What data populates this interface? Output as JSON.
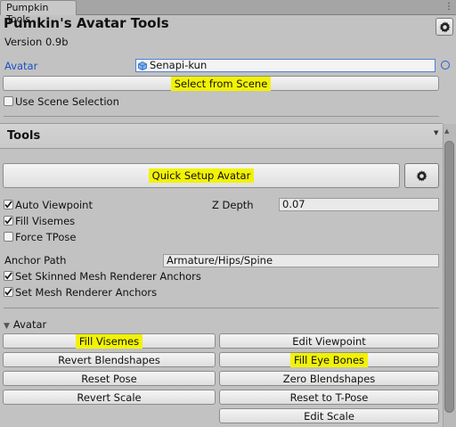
{
  "tab": {
    "label": "Pumpkin Tools",
    "menu_icon": "kebab-menu-icon"
  },
  "header": {
    "title": "Pumkin's Avatar Tools",
    "version": "Version 0.9b",
    "settings_icon": "gear-icon"
  },
  "avatar_field": {
    "label": "Avatar",
    "value": "Senapi-kun",
    "object_icon": "cube-icon",
    "picker_icon": "object-picker-icon"
  },
  "select_button": {
    "label": "Select from Scene"
  },
  "use_scene_selection": {
    "label": "Use Scene Selection",
    "checked": false
  },
  "tools_section": {
    "title": "Tools",
    "collapse_icon": "dropdown-arrow-icon"
  },
  "quick_setup": {
    "label": "Quick Setup Avatar",
    "settings_icon": "gear-icon"
  },
  "options": {
    "auto_viewpoint": {
      "label": "Auto Viewpoint",
      "checked": true
    },
    "fill_visemes": {
      "label": "Fill Visemes",
      "checked": true
    },
    "force_tpose": {
      "label": "Force TPose",
      "checked": false
    },
    "z_depth": {
      "label": "Z Depth",
      "value": "0.07"
    },
    "anchor_path": {
      "label": "Anchor Path",
      "value": "Armature/Hips/Spine"
    },
    "set_skinned_anchors": {
      "label": "Set Skinned Mesh Renderer Anchors",
      "checked": true
    },
    "set_mesh_anchors": {
      "label": "Set Mesh Renderer Anchors",
      "checked": true
    }
  },
  "avatar_foldout": {
    "label": "Avatar",
    "expanded": true
  },
  "avatar_buttons": {
    "fill_visemes": "Fill Visemes",
    "edit_viewpoint": "Edit Viewpoint",
    "revert_blendshapes": "Revert Blendshapes",
    "fill_eye_bones": "Fill Eye Bones",
    "reset_pose": "Reset Pose",
    "zero_blendshapes": "Zero Blendshapes",
    "revert_scale": "Revert Scale",
    "reset_to_tpose": "Reset to T-Pose",
    "edit_scale": "Edit Scale"
  },
  "colors": {
    "highlight": "#f2f205",
    "link_blue": "#1e4fc4",
    "background": "#c2c2c2"
  }
}
